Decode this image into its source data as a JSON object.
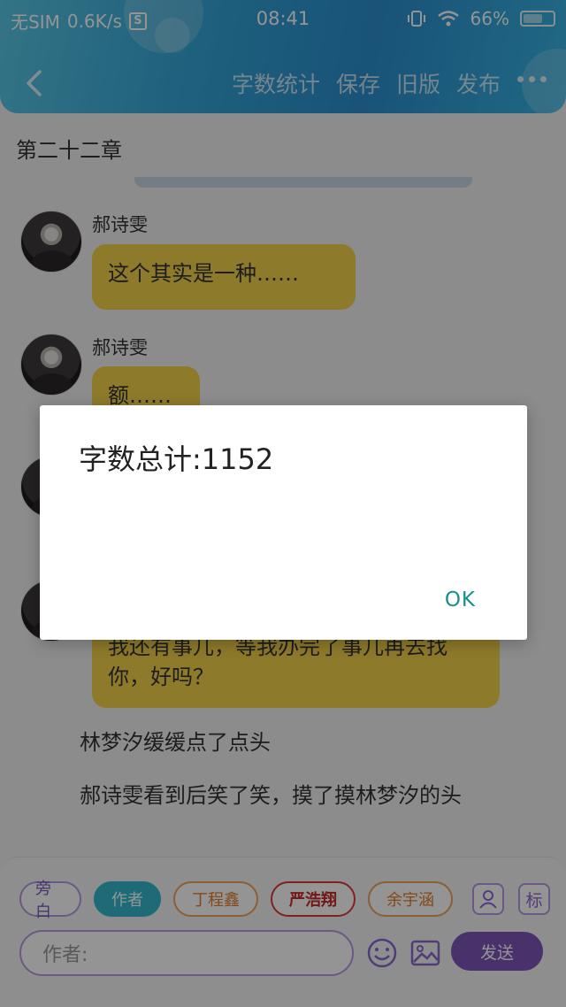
{
  "status_bar": {
    "carrier": "无SIM",
    "net_speed": "0.6K/s",
    "sim_icon": "S",
    "time": "08:41",
    "battery": "66%",
    "battery_level": 0.66
  },
  "nav": {
    "back_icon": "chevron-left-icon",
    "actions": [
      "字数统计",
      "保存",
      "旧版",
      "发布"
    ],
    "more_icon": "more-dots-icon"
  },
  "chapter_title": "第二十二章",
  "messages": [
    {
      "speaker": "郝诗雯",
      "text": "这个其实是一种……"
    },
    {
      "speaker": "郝诗雯",
      "text": "额……"
    },
    {
      "speaker": "",
      "text": "我还有事儿，等我办完了事儿再去找你，好吗？"
    }
  ],
  "narration": [
    "林梦汐缓缓点了点头",
    "郝诗雯看到后笑了笑，摸了摸林梦汐的头"
  ],
  "roles": [
    "旁白",
    "作者",
    "丁程鑫",
    "严浩翔",
    "余宇涵"
  ],
  "role_icons": {
    "contact": "person-icon",
    "tag": "标"
  },
  "input": {
    "value": "作者:"
  },
  "send_label": "发送",
  "dialog": {
    "message": "字数总计:1152",
    "ok": "OK"
  },
  "colors": {
    "accent": "#35b9cf",
    "bubble": "#f5d34a",
    "send": "#7e56b8",
    "ok": "#1a8f8a"
  }
}
